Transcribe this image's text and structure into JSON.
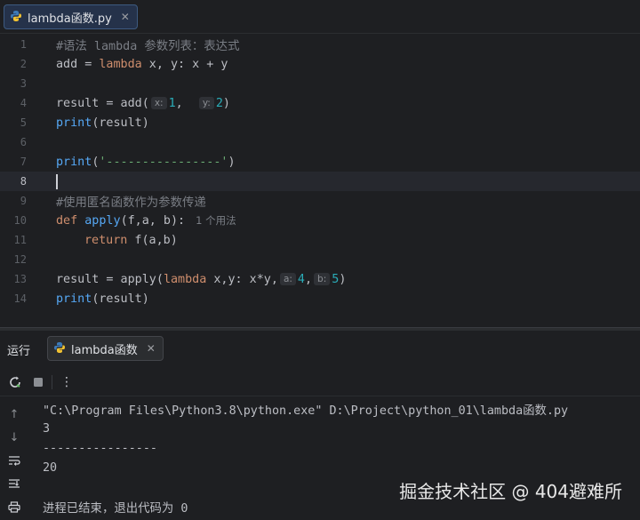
{
  "editor_tab": {
    "filename": "lambda函数.py",
    "close": "✕"
  },
  "editor": {
    "line_numbers": [
      "1",
      "2",
      "3",
      "4",
      "5",
      "6",
      "7",
      "8",
      "9",
      "10",
      "11",
      "12",
      "13",
      "14"
    ],
    "line1_comment": "#语法 lambda 参数列表：表达式",
    "line2": {
      "var": "add = ",
      "kw": "lambda",
      "rest": " x, y: x + y"
    },
    "line4": {
      "pre": "result = add(",
      "hint_x": "x:",
      "val_x": "1",
      "sep": ",  ",
      "hint_y": "y:",
      "val_y": "2",
      "post": ")"
    },
    "line5": {
      "fn": "print",
      "rest": "(result)"
    },
    "line7": {
      "fn": "print",
      "open": "(",
      "str": "'----------------'",
      "close": ")"
    },
    "line9_comment": "#使用匿名函数作为参数传递",
    "line10": {
      "kw": "def",
      "fn": "apply",
      "rest": "(f,a, b):",
      "usage": "1 个用法"
    },
    "line11": {
      "kw": "return",
      "rest": " f(a,b)"
    },
    "line13": {
      "pre": "result = apply(",
      "kw": "lambda",
      "mid": " x,y: x*y,",
      "hint_a": "a:",
      "val_a": "4",
      "sep": ",",
      "hint_b": "b:",
      "val_b": "5",
      "post": ")"
    },
    "line14": {
      "fn": "print",
      "rest": "(result)"
    }
  },
  "run_panel": {
    "title": "运行",
    "tab_label": "lambda函数",
    "tab_close": "✕",
    "menu": "⋮",
    "console": [
      "\"C:\\Program Files\\Python3.8\\python.exe\" D:\\Project\\python_01\\lambda函数.py",
      "3",
      "----------------",
      "20",
      "",
      "进程已结束，退出代码为 0"
    ]
  },
  "watermark": "掘金技术社区 @ 404避难所"
}
